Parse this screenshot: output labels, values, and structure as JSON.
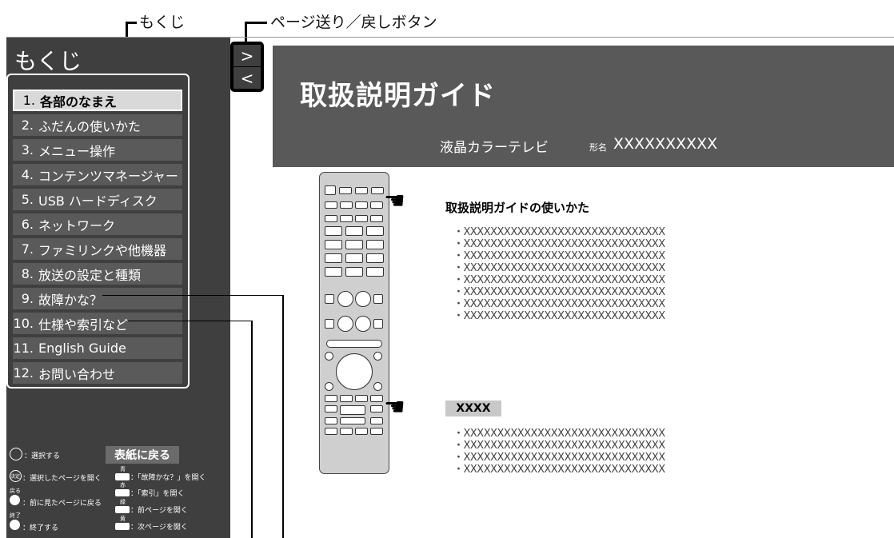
{
  "callouts": {
    "toc": "もくじ",
    "page_buttons": "ページ送り／戻しボタン"
  },
  "sidebar": {
    "title": "もくじ",
    "items": [
      {
        "num": "1.",
        "label": "各部のなまえ",
        "active": true
      },
      {
        "num": "2.",
        "label": "ふだんの使いかた"
      },
      {
        "num": "3.",
        "label": "メニュー操作"
      },
      {
        "num": "4.",
        "label": "コンテンツマネージャー"
      },
      {
        "num": "5.",
        "label": "USB ハードディスク"
      },
      {
        "num": "6.",
        "label": "ネットワーク"
      },
      {
        "num": "7.",
        "label": "ファミリンクや他機器"
      },
      {
        "num": "8.",
        "label": "放送の設定と種類"
      },
      {
        "num": "9.",
        "label": "故障かな？"
      },
      {
        "num": "10.",
        "label": "仕様や索引など"
      },
      {
        "num": "11.",
        "label": "English Guide"
      },
      {
        "num": "12.",
        "label": "お問い合わせ"
      }
    ],
    "back_to_cover": "表紙に戻る",
    "legend": {
      "select": "：選択する",
      "enter_key": "決定",
      "open_selected": "：選択したページを開く",
      "back_key": "戻る",
      "back": "：前に見たページに戻る",
      "exit_key": "終了",
      "exit": "：終了する",
      "blue_key": "青",
      "blue": "：「故障かな？」を開く",
      "red_key": "赤",
      "red": "：「索引」を開く",
      "green_key": "緑",
      "green": "：前ページを開く",
      "yellow_key": "黄",
      "yellow": "：次ページを開く"
    }
  },
  "page_buttons": {
    "next": ">",
    "prev": "<"
  },
  "header": {
    "title": "取扱説明ガイド",
    "product": "液晶カラーテレビ",
    "model_label": "形名",
    "model": "XXXXXXXXXX"
  },
  "content": {
    "section1": {
      "title": "取扱説明ガイドの使いかた",
      "lines": [
        "・XXXXXXXXXXXXXXXXXXXXXXXXXXXXXX",
        "・XXXXXXXXXXXXXXXXXXXXXXXXXXXXXX",
        "・XXXXXXXXXXXXXXXXXXXXXXXXXXXXXX",
        "・XXXXXXXXXXXXXXXXXXXXXXXXXXXXXX",
        "・XXXXXXXXXXXXXXXXXXXXXXXXXXXXXX",
        "・XXXXXXXXXXXXXXXXXXXXXXXXXXXXXX",
        "・XXXXXXXXXXXXXXXXXXXXXXXXXXXXXX",
        "・XXXXXXXXXXXXXXXXXXXXXXXXXXXXXX"
      ]
    },
    "section2": {
      "title": "XXXX",
      "lines": [
        "・XXXXXXXXXXXXXXXXXXXXXXXXXXXXXX",
        "・XXXXXXXXXXXXXXXXXXXXXXXXXXXXXX",
        "・XXXXXXXXXXXXXXXXXXXXXXXXXXXXXX",
        "・XXXXXXXXXXXXXXXXXXXXXXXXXXXXXX"
      ]
    }
  },
  "icons": {
    "remote": "remote-control-icon",
    "pointer": "pointing-hand-icon",
    "dpad": "dpad-icon"
  }
}
